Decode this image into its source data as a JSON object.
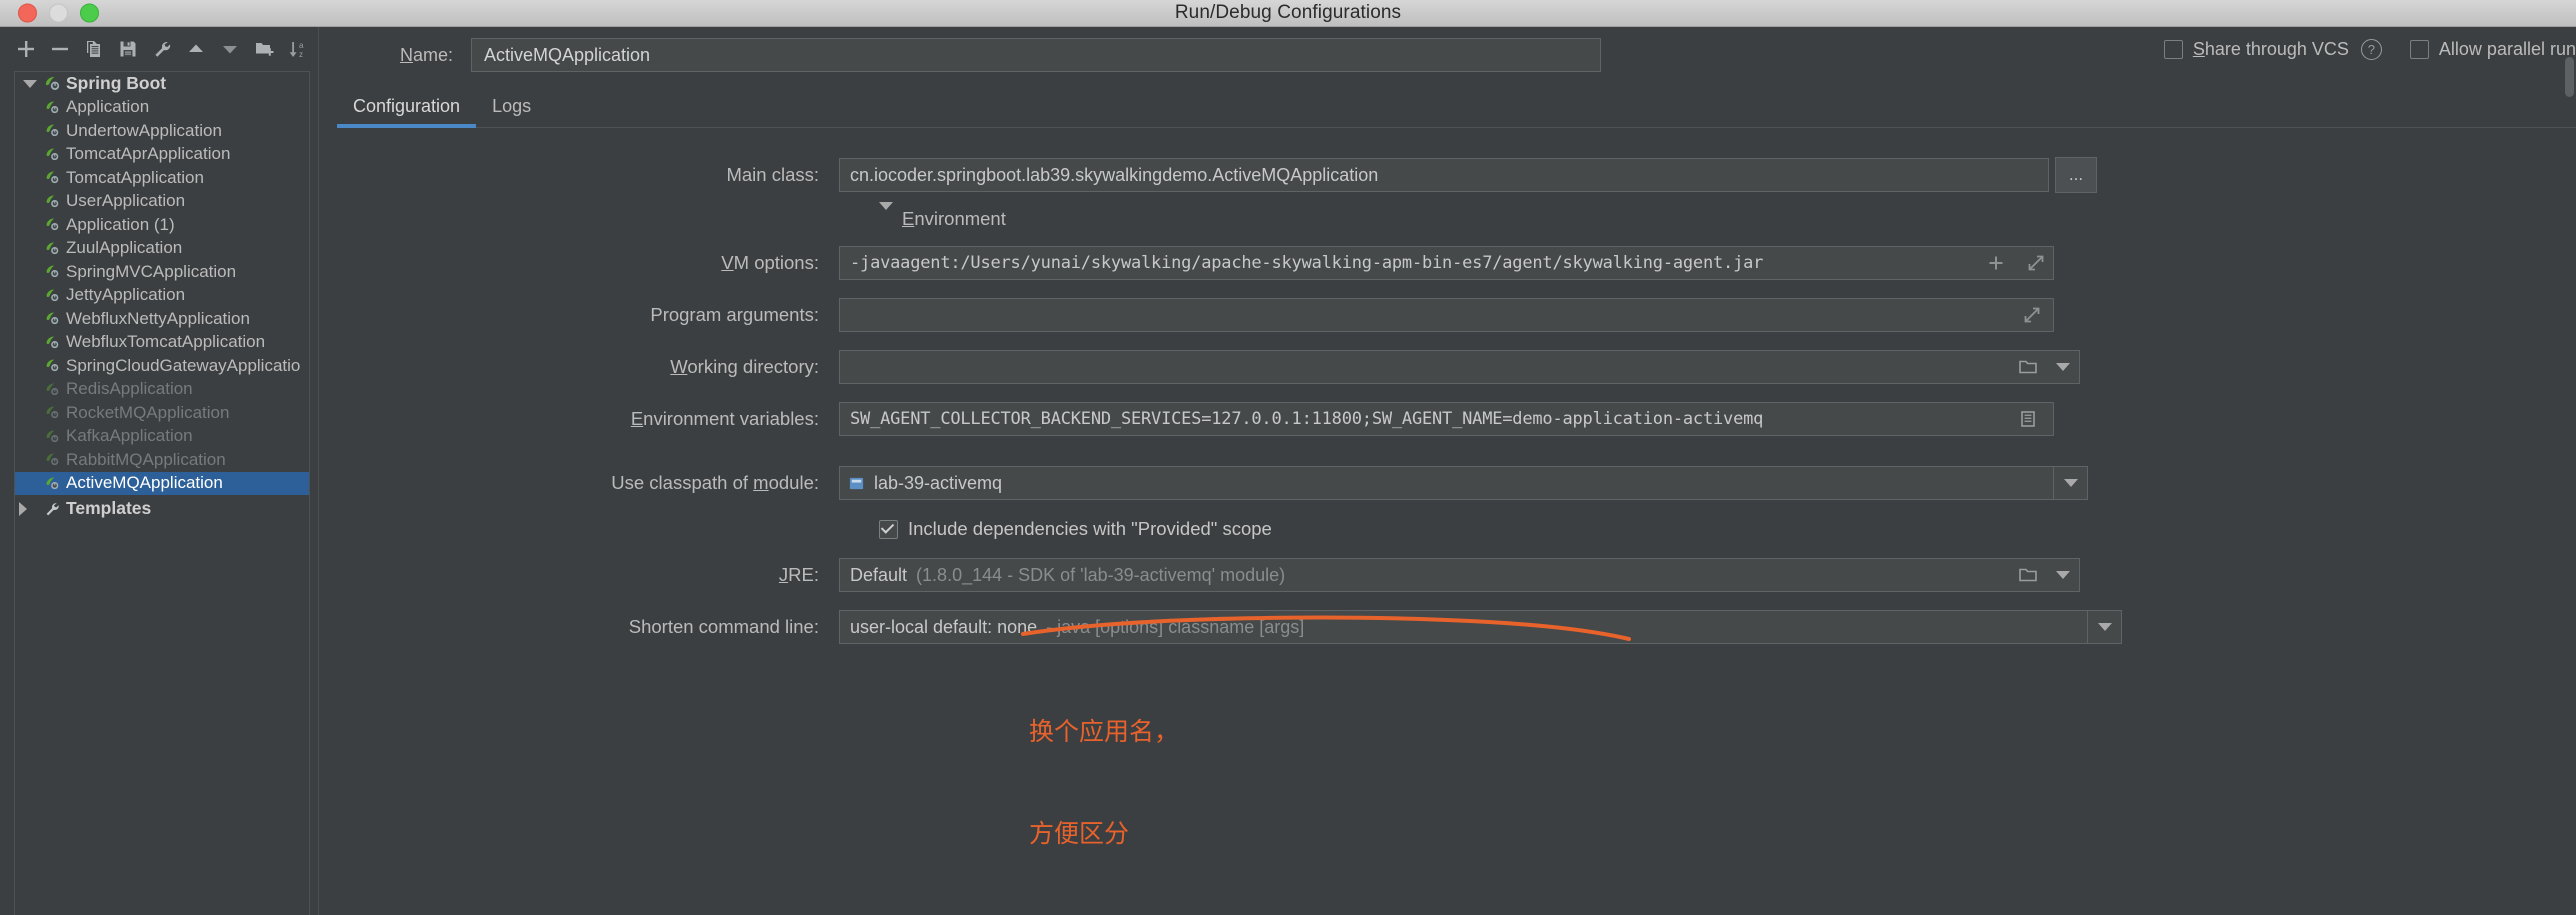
{
  "window": {
    "title": "Run/Debug Configurations"
  },
  "toolbar": {
    "buttons": [
      {
        "name": "add-configuration-button",
        "icon": "plus-icon"
      },
      {
        "name": "remove-configuration-button",
        "icon": "minus-icon"
      },
      {
        "name": "copy-configuration-button",
        "icon": "copy-icon"
      },
      {
        "name": "save-configuration-button",
        "icon": "save-icon"
      },
      {
        "name": "edit-templates-button",
        "icon": "wrench-icon"
      },
      {
        "name": "move-up-button",
        "icon": "arrow-up-icon"
      },
      {
        "name": "move-down-button",
        "icon": "arrow-down-icon"
      },
      {
        "name": "create-folder-button",
        "icon": "folder-add-icon"
      },
      {
        "name": "sort-configurations-button",
        "icon": "sort-az-icon"
      }
    ]
  },
  "tree": {
    "root": {
      "label": "Spring Boot",
      "icon": "spring-boot-icon",
      "expanded": true
    },
    "items": [
      {
        "label": "Application",
        "dim": false,
        "selected": false
      },
      {
        "label": "UndertowApplication",
        "dim": false,
        "selected": false
      },
      {
        "label": "TomcatAprApplication",
        "dim": false,
        "selected": false
      },
      {
        "label": "TomcatApplication",
        "dim": false,
        "selected": false
      },
      {
        "label": "UserApplication",
        "dim": false,
        "selected": false
      },
      {
        "label": "Application (1)",
        "dim": false,
        "selected": false
      },
      {
        "label": "ZuulApplication",
        "dim": false,
        "selected": false
      },
      {
        "label": "SpringMVCApplication",
        "dim": false,
        "selected": false
      },
      {
        "label": "JettyApplication",
        "dim": false,
        "selected": false
      },
      {
        "label": "WebfluxNettyApplication",
        "dim": false,
        "selected": false
      },
      {
        "label": "WebfluxTomcatApplication",
        "dim": false,
        "selected": false
      },
      {
        "label": "SpringCloudGatewayApplicatio",
        "dim": false,
        "selected": false
      },
      {
        "label": "RedisApplication",
        "dim": true,
        "selected": false
      },
      {
        "label": "RocketMQApplication",
        "dim": true,
        "selected": false
      },
      {
        "label": "KafkaApplication",
        "dim": true,
        "selected": false
      },
      {
        "label": "RabbitMQApplication",
        "dim": true,
        "selected": false
      },
      {
        "label": "ActiveMQApplication",
        "dim": false,
        "selected": true
      }
    ],
    "templates": {
      "label": "Templates",
      "icon": "wrench-icon",
      "expanded": false
    }
  },
  "header": {
    "name_label": "Name:",
    "name_label_mnemonic": "N",
    "name_value": "ActiveMQApplication",
    "share_vcs_label": "Share through VCS",
    "share_vcs_mnemonic": "S",
    "share_vcs_checked": false,
    "help_icon": "help-icon",
    "allow_parallel_label": "Allow parallel run",
    "allow_parallel_checked": false
  },
  "tabs": [
    {
      "label": "Configuration",
      "active": true
    },
    {
      "label": "Logs",
      "active": false
    }
  ],
  "form": {
    "main_class": {
      "label": "Main class:",
      "value": "cn.iocoder.springboot.lab39.skywalkingdemo.ActiveMQApplication",
      "browse_label": "..."
    },
    "environment_section": {
      "label": "Environment",
      "expanded": true
    },
    "vm_options": {
      "label": "VM options:",
      "label_mnemonic": "V",
      "value": "-javaagent:/Users/yunai/skywalking/apache-skywalking-apm-bin-es7/agent/skywalking-agent.jar",
      "icons": [
        "plus-icon",
        "expand-icon"
      ]
    },
    "program_arguments": {
      "label": "Program arguments:",
      "label_mnemonic": "g",
      "value": "",
      "icons": [
        "expand-icon"
      ]
    },
    "working_directory": {
      "label": "Working directory:",
      "label_mnemonic": "W",
      "value": "",
      "icons": [
        "folder-icon",
        "chevron-down-icon"
      ]
    },
    "environment_variables": {
      "label": "Environment variables:",
      "label_mnemonic": "E",
      "value": "SW_AGENT_COLLECTOR_BACKEND_SERVICES=127.0.0.1:11800;SW_AGENT_NAME=demo-application-activemq",
      "icons": [
        "browse-env-icon"
      ]
    },
    "classpath_module": {
      "label": "Use classpath of module:",
      "label_mnemonic": "m",
      "value": "lab-39-activemq",
      "icon": "module-icon",
      "dropdown_icon": "chevron-down-icon"
    },
    "include_provided": {
      "label": "Include dependencies with \"Provided\" scope",
      "checked": true
    },
    "jre": {
      "label": "JRE:",
      "label_mnemonic": "J",
      "value": "Default",
      "value_hint": "(1.8.0_144 - SDK of 'lab-39-activemq' module)",
      "icons": [
        "folder-icon",
        "chevron-down-icon"
      ]
    },
    "shorten_command_line": {
      "label": "Shorten command line:",
      "value": "user-local default: none",
      "value_hint": "- java [options] classname [args]",
      "dropdown_icon": "chevron-down-icon"
    }
  },
  "annotation": {
    "line1": "换个应用名，",
    "line2": "方便区分",
    "color": "#e8622c"
  }
}
